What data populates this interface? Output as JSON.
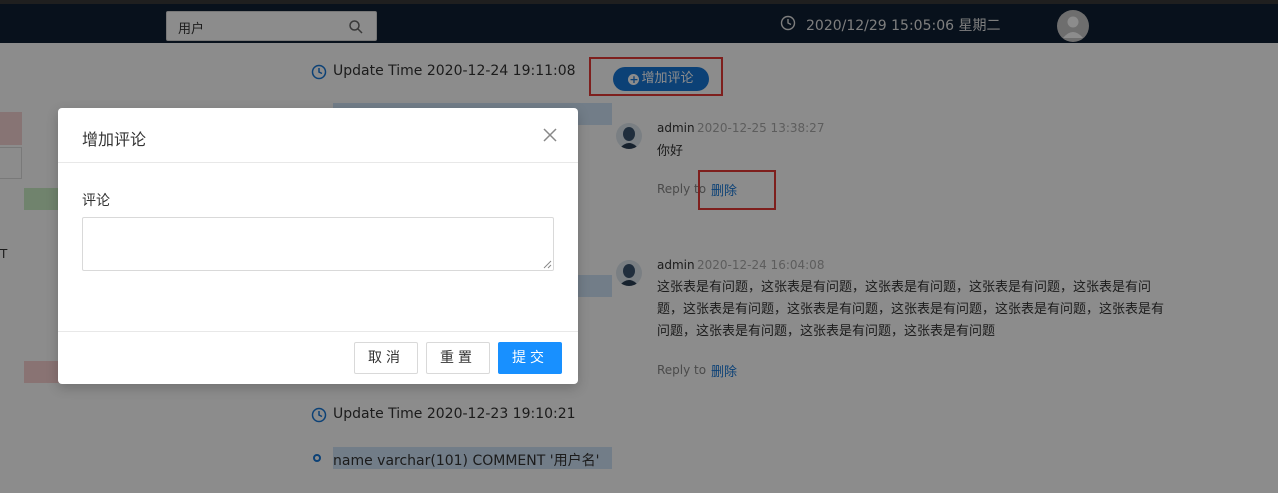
{
  "topbar": {
    "search_value": "用户",
    "datetime": "2020/12/29 15:05:06 星期二"
  },
  "timeline": {
    "update1": "Update Time 2020-12-24 19:11:08",
    "add_comment_label": "增加评论",
    "update2": "Update Time 2020-12-23 19:10:21",
    "field_line": "name varchar(101) COMMENT '用户名'",
    "left_edge_text": "T"
  },
  "comments": [
    {
      "author": "admin",
      "date": "2020-12-25 13:38:27",
      "text": "你好",
      "reply_label": "Reply to",
      "delete_label": "删除"
    },
    {
      "author": "admin",
      "date": "2020-12-24 16:04:08",
      "text_lines": [
        "这张表是有问题，这张表是有问题，这张表是有问题，这张表是有问题，这张表是有问",
        "题，这张表是有问题，这张表是有问题，这张表是有问题，这张表是有问题，这张表是有",
        "问题，这张表是有问题，这张表是有问题，这张表是有问题"
      ],
      "reply_label": "Reply to",
      "delete_label": "删除"
    }
  ],
  "modal": {
    "title": "增加评论",
    "field_label": "评论",
    "textarea_value": "",
    "cancel_label": "取消",
    "reset_label": "重置",
    "submit_label": "提交"
  },
  "colors": {
    "accent": "#1890ff",
    "highlight_box": "#e53935",
    "topbar": "#0f1f33"
  }
}
